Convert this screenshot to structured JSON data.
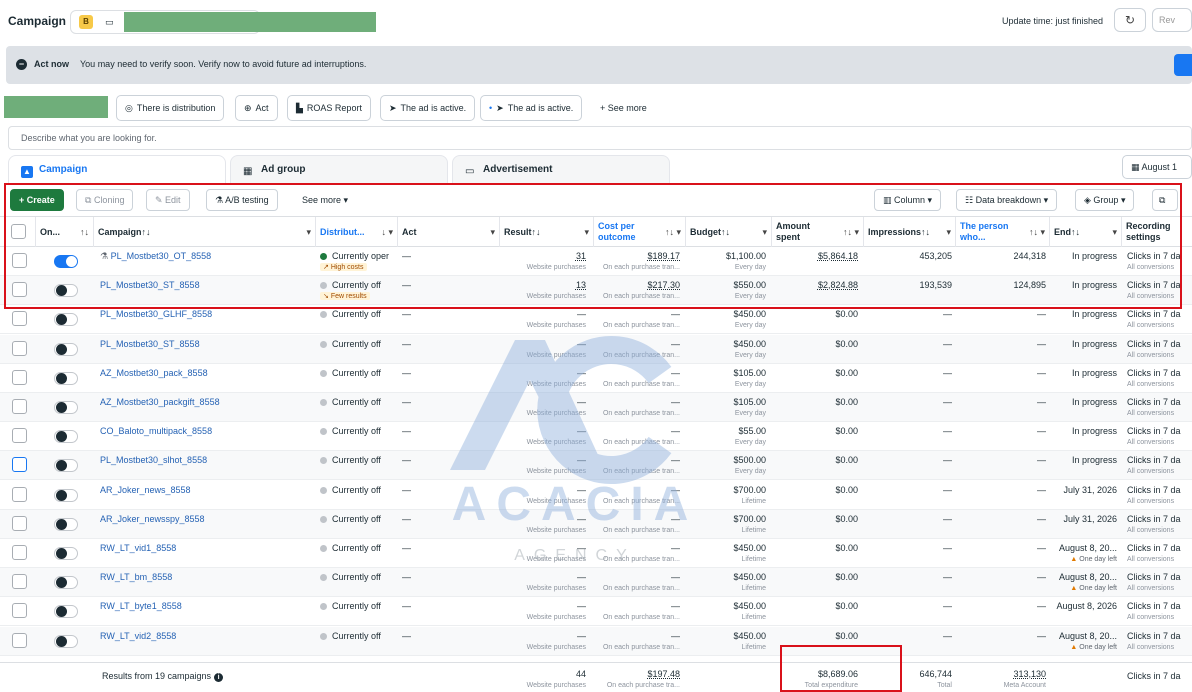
{
  "header": {
    "title": "Campaign",
    "account_badge": "B",
    "update_text": "Update time: just finished",
    "review_label": "Rev"
  },
  "alert": {
    "strong": "Act now",
    "text": "You may need to verify soon. Verify now to avoid future ad interruptions."
  },
  "filters": {
    "chips": [
      "There is distribution",
      "Act",
      "ROAS Report",
      "The ad is active.",
      "The ad is active."
    ],
    "see_more": "See more",
    "search_placeholder": "Describe what you are looking for."
  },
  "tabs": {
    "campaign": "Campaign",
    "ad_group": "Ad group",
    "advertisement": "Advertisement",
    "date": "August 1"
  },
  "toolbar": {
    "create": "+ Create",
    "cloning": "Cloning",
    "edit": "Edit",
    "ab_testing": "A/B testing",
    "see_more": "See more",
    "column": "Column",
    "data_breakdown": "Data breakdown",
    "group": "Group"
  },
  "columns": {
    "on_off": "On...",
    "campaign": "Campaign",
    "delivery": "Distribut...",
    "act": "Act",
    "result": "Result",
    "cost_per_outcome_1": "Cost per",
    "cost_per_outcome_2": "outcome",
    "budget": "Budget",
    "amount_spent_1": "Amount",
    "amount_spent_2": "spent",
    "impressions": "Impressions",
    "person_who_1": "The person",
    "person_who_2": "who...",
    "end": "End",
    "recording_1": "Recording",
    "recording_2": "settings"
  },
  "subtexts": {
    "website_purchases": "Website purchases",
    "each_purchase": "On each purchase tran...",
    "every_day": "Every day",
    "lifetime": "Lifetime",
    "all_conversions": "All conversions",
    "one_day_left": "One day left",
    "dash": "—"
  },
  "rows": [
    {
      "name": "PL_Mostbet30_OT_8558",
      "on": true,
      "delivery": "Currently oper",
      "active": true,
      "badge": "High costs",
      "result": "31",
      "cost": "$189.17",
      "budget": "$1,100.00",
      "budget_type": "Every day",
      "spent": "$5,864.18",
      "impressions": "453,205",
      "person": "244,318",
      "end": "In progress",
      "recording": "Clicks in 7 da",
      "warn": ""
    },
    {
      "name": "PL_Mostbet30_ST_8558",
      "on": false,
      "delivery": "Currently off",
      "active": false,
      "badge": "Few results",
      "result": "13",
      "cost": "$217.30",
      "budget": "$550.00",
      "budget_type": "Every day",
      "spent": "$2,824.88",
      "impressions": "193,539",
      "person": "124,895",
      "end": "In progress",
      "recording": "Clicks in 7 da",
      "warn": ""
    },
    {
      "name": "PL_Mostbet30_GLHF_8558",
      "on": false,
      "delivery": "Currently off",
      "active": false,
      "badge": "",
      "result": "—",
      "cost": "—",
      "budget": "$450.00",
      "budget_type": "Every day",
      "spent": "$0.00",
      "impressions": "—",
      "person": "—",
      "end": "In progress",
      "recording": "Clicks in 7 da",
      "warn": ""
    },
    {
      "name": "PL_Mostbet30_ST_8558",
      "on": false,
      "delivery": "Currently off",
      "active": false,
      "badge": "",
      "result": "—",
      "cost": "—",
      "budget": "$450.00",
      "budget_type": "Every day",
      "spent": "$0.00",
      "impressions": "—",
      "person": "—",
      "end": "In progress",
      "recording": "Clicks in 7 da",
      "warn": ""
    },
    {
      "name": "AZ_Mostbet30_pack_8558",
      "on": false,
      "delivery": "Currently off",
      "active": false,
      "badge": "",
      "result": "—",
      "cost": "—",
      "budget": "$105.00",
      "budget_type": "Every day",
      "spent": "$0.00",
      "impressions": "—",
      "person": "—",
      "end": "In progress",
      "recording": "Clicks in 7 da",
      "warn": ""
    },
    {
      "name": "AZ_Mostbet30_packgift_8558",
      "on": false,
      "delivery": "Currently off",
      "active": false,
      "badge": "",
      "result": "—",
      "cost": "—",
      "budget": "$105.00",
      "budget_type": "Every day",
      "spent": "$0.00",
      "impressions": "—",
      "person": "—",
      "end": "In progress",
      "recording": "Clicks in 7 da",
      "warn": ""
    },
    {
      "name": "CO_Baloto_multipack_8558",
      "on": false,
      "delivery": "Currently off",
      "active": false,
      "badge": "",
      "result": "—",
      "cost": "—",
      "budget": "$55.00",
      "budget_type": "Every day",
      "spent": "$0.00",
      "impressions": "—",
      "person": "—",
      "end": "In progress",
      "recording": "Clicks in 7 da",
      "warn": ""
    },
    {
      "name": "PL_Mostbet30_slhot_8558",
      "on": false,
      "delivery": "Currently off",
      "active": false,
      "badge": "",
      "result": "—",
      "cost": "—",
      "budget": "$500.00",
      "budget_type": "Every day",
      "spent": "$0.00",
      "impressions": "—",
      "person": "—",
      "end": "In progress",
      "recording": "Clicks in 7 da",
      "warn": ""
    },
    {
      "name": "AR_Joker_news_8558",
      "on": false,
      "delivery": "Currently off",
      "active": false,
      "badge": "",
      "result": "—",
      "cost": "—",
      "budget": "$700.00",
      "budget_type": "Lifetime",
      "spent": "$0.00",
      "impressions": "—",
      "person": "—",
      "end": "July 31, 2026",
      "recording": "Clicks in 7 da",
      "warn": ""
    },
    {
      "name": "AR_Joker_newsspy_8558",
      "on": false,
      "delivery": "Currently off",
      "active": false,
      "badge": "",
      "result": "—",
      "cost": "—",
      "budget": "$700.00",
      "budget_type": "Lifetime",
      "spent": "$0.00",
      "impressions": "—",
      "person": "—",
      "end": "July 31, 2026",
      "recording": "Clicks in 7 da",
      "warn": ""
    },
    {
      "name": "RW_LT_vid1_8558",
      "on": false,
      "delivery": "Currently off",
      "active": false,
      "badge": "",
      "result": "—",
      "cost": "—",
      "budget": "$450.00",
      "budget_type": "Lifetime",
      "spent": "$0.00",
      "impressions": "—",
      "person": "—",
      "end": "August 8, 20...",
      "recording": "Clicks in 7 da",
      "warn": "One day left"
    },
    {
      "name": "RW_LT_bm_8558",
      "on": false,
      "delivery": "Currently off",
      "active": false,
      "badge": "",
      "result": "—",
      "cost": "—",
      "budget": "$450.00",
      "budget_type": "Lifetime",
      "spent": "$0.00",
      "impressions": "—",
      "person": "—",
      "end": "August 8, 20...",
      "recording": "Clicks in 7 da",
      "warn": "One day left"
    },
    {
      "name": "RW_LT_byte1_8558",
      "on": false,
      "delivery": "Currently off",
      "active": false,
      "badge": "",
      "result": "—",
      "cost": "—",
      "budget": "$450.00",
      "budget_type": "Lifetime",
      "spent": "$0.00",
      "impressions": "—",
      "person": "—",
      "end": "August 8, 2026",
      "recording": "Clicks in 7 da",
      "warn": ""
    },
    {
      "name": "RW_LT_vid2_8558",
      "on": false,
      "delivery": "Currently off",
      "active": false,
      "badge": "",
      "result": "—",
      "cost": "—",
      "budget": "$450.00",
      "budget_type": "Lifetime",
      "spent": "$0.00",
      "impressions": "—",
      "person": "—",
      "end": "August 8, 20...",
      "recording": "Clicks in 7 da",
      "warn": "One day left"
    }
  ],
  "footer": {
    "label": "Results from 19 campaigns",
    "result": "44",
    "result_sub": "Website purchases",
    "cost": "$197.48",
    "cost_sub": "On each purchase tra...",
    "spent": "$8,689.06",
    "spent_sub": "Total expenditure",
    "impressions": "646,744",
    "impressions_sub": "Total",
    "person": "313,130",
    "person_sub": "Meta Account",
    "recording": "Clicks in 7 da"
  },
  "watermark": {
    "logo": "AC",
    "name": "ACACIA",
    "sub": "AGENCY"
  },
  "colors": {
    "accent": "#1877f2",
    "create_green": "#1e7a3e",
    "highlight_red": "#d9111a"
  }
}
